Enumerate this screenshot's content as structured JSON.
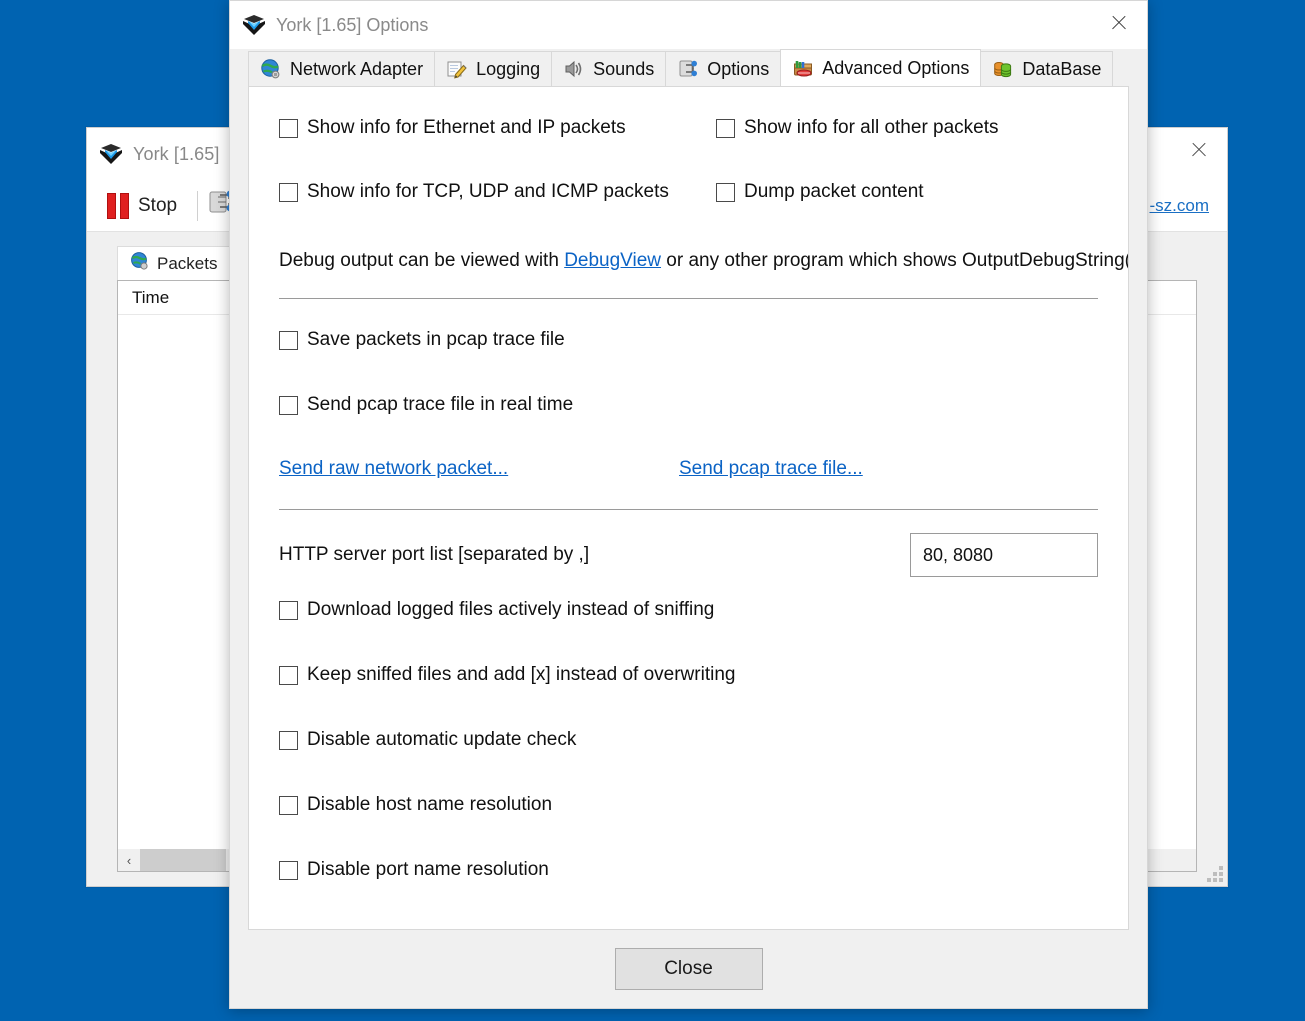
{
  "desktop": {
    "background_color": "#0063b1"
  },
  "main_window": {
    "title": "York [1.65]",
    "icon": "york-crest-icon",
    "close_icon": "close-icon",
    "toolbar": {
      "stop_label": "Stop",
      "stop_icon": "pause-icon",
      "network_adapter_icon": "network-adapter-icon"
    },
    "link_text": "-sz.com",
    "tabs": [
      {
        "label": "Packets",
        "icon": "globe-icon",
        "active": true
      },
      {
        "label": "",
        "icon": "logging-icon",
        "active": false
      }
    ],
    "list": {
      "column_header": "Time",
      "rows": []
    },
    "hscroll": {
      "left_arrow": "‹",
      "right_arrow": "›"
    }
  },
  "dialog": {
    "title": "York [1.65] Options",
    "icon": "york-crest-icon",
    "close_icon": "close-icon",
    "tabs": [
      {
        "label": "Network Adapter",
        "icon": "globe-icon",
        "active": false
      },
      {
        "label": "Logging",
        "icon": "notepad-pencil-icon",
        "active": false
      },
      {
        "label": "Sounds",
        "icon": "speaker-icon",
        "active": false
      },
      {
        "label": "Options",
        "icon": "switch-icon",
        "active": false
      },
      {
        "label": "Advanced Options",
        "icon": "toolbox-icon",
        "active": true
      },
      {
        "label": "DataBase",
        "icon": "database-icon",
        "active": false
      }
    ],
    "advanced_options": {
      "debug_checkboxes": [
        {
          "label": "Show info for Ethernet and IP packets",
          "checked": false
        },
        {
          "label": "Show info for all other packets",
          "checked": false
        },
        {
          "label": "Show info for TCP, UDP and ICMP packets",
          "checked": false
        },
        {
          "label": "Dump packet content",
          "checked": false
        }
      ],
      "debug_note": {
        "prefix": "Debug output can be viewed with ",
        "link": "DebugView",
        "suffix": " or any other program which shows OutputDebugString()."
      },
      "pcap_checkboxes": [
        {
          "label": "Save packets in pcap trace file",
          "checked": false
        },
        {
          "label": "Send pcap trace file in real time",
          "checked": false
        }
      ],
      "pcap_links": [
        {
          "label": "Send raw network packet..."
        },
        {
          "label": "Send pcap trace file..."
        }
      ],
      "http_port": {
        "label": "HTTP server port list [separated by ,]",
        "value": "80, 8080",
        "placeholder": ""
      },
      "bottom_checkboxes": [
        {
          "label": "Download logged files actively instead of sniffing",
          "checked": false
        },
        {
          "label": "Keep sniffed files and add [x] instead of overwriting",
          "checked": false
        },
        {
          "label": "Disable automatic update check",
          "checked": false
        },
        {
          "label": "Disable host name resolution",
          "checked": false
        },
        {
          "label": "Disable port name resolution",
          "checked": false
        }
      ]
    },
    "footer": {
      "close_label": "Close"
    }
  },
  "colors": {
    "desktop_blue": "#0063b1",
    "link_blue": "#0b63c5",
    "dialog_chrome": "#f0f0f0",
    "accent_red": "#e02020"
  }
}
